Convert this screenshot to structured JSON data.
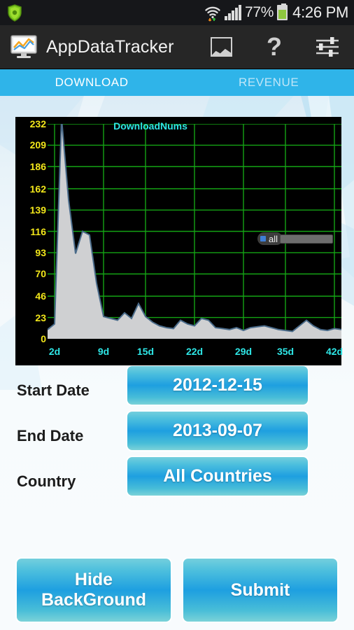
{
  "status_bar": {
    "notification_icon": "shield-icon",
    "wifi_icon": "wifi-icon",
    "signal_icon": "cell-signal-icon",
    "battery_percent": "77%",
    "battery_icon": "battery-icon",
    "time": "4:26 PM"
  },
  "action_bar": {
    "logo_icon": "monitor-chart-icon",
    "title": "AppDataTracker",
    "actions": [
      {
        "name": "gallery-icon",
        "label": ""
      },
      {
        "name": "help-icon",
        "label": "?"
      },
      {
        "name": "settings-sliders-icon",
        "label": ""
      }
    ]
  },
  "tabs": [
    {
      "label": "DOWNLOAD",
      "active": true
    },
    {
      "label": "REVENUE",
      "active": false
    }
  ],
  "legend": {
    "label": "all",
    "dot_color": "#3f7fd6"
  },
  "form": {
    "rows": [
      {
        "label": "Start Date",
        "value": "2012-12-15"
      },
      {
        "label": "End Date",
        "value": "2013-09-07"
      },
      {
        "label": "Country",
        "value": "All Countries"
      }
    ]
  },
  "bottom_buttons": [
    {
      "label": "Hide\nBackGround"
    },
    {
      "label": "Submit"
    }
  ],
  "colors": {
    "accent": "#2fb4e9",
    "tab_active_text": "#ffffff",
    "tab_inactive_text": "#bfe6f8",
    "chart_bg": "#000000",
    "grid": "#14a314",
    "y_tick": "#f2e61a",
    "x_tick": "#2ee6e6",
    "title": "#2ee6e6",
    "series_fill": "#cfd0d2",
    "series_line": "#4a6b8a",
    "button_gradient_mid": "#1e9fe0"
  },
  "chart_data": {
    "type": "area",
    "title": "DownloadNums",
    "xlabel": "",
    "ylabel": "",
    "grid": true,
    "legend_position": "right",
    "series_name": "all",
    "ylim": [
      0,
      232
    ],
    "yticks": [
      0,
      23,
      46,
      70,
      93,
      116,
      139,
      162,
      186,
      209,
      232
    ],
    "xticks": [
      "2d",
      "9d",
      "15d",
      "22d",
      "29d",
      "35d",
      "42d"
    ],
    "xtick_days": [
      2,
      9,
      15,
      22,
      29,
      35,
      42
    ],
    "xlim": [
      1,
      43
    ],
    "x": [
      1,
      2,
      3,
      4,
      5,
      6,
      7,
      8,
      9,
      10,
      11,
      12,
      13,
      14,
      15,
      16,
      17,
      18,
      19,
      20,
      21,
      22,
      23,
      24,
      25,
      26,
      27,
      28,
      29,
      30,
      31,
      32,
      33,
      34,
      35,
      36,
      37,
      38,
      39,
      40,
      41,
      42,
      43
    ],
    "values": [
      10,
      16,
      238,
      150,
      92,
      116,
      112,
      60,
      24,
      22,
      20,
      28,
      22,
      38,
      24,
      18,
      14,
      12,
      11,
      20,
      16,
      14,
      22,
      20,
      12,
      11,
      10,
      12,
      9,
      12,
      13,
      14,
      12,
      10,
      9,
      8,
      14,
      20,
      14,
      10,
      9,
      11,
      10
    ]
  }
}
